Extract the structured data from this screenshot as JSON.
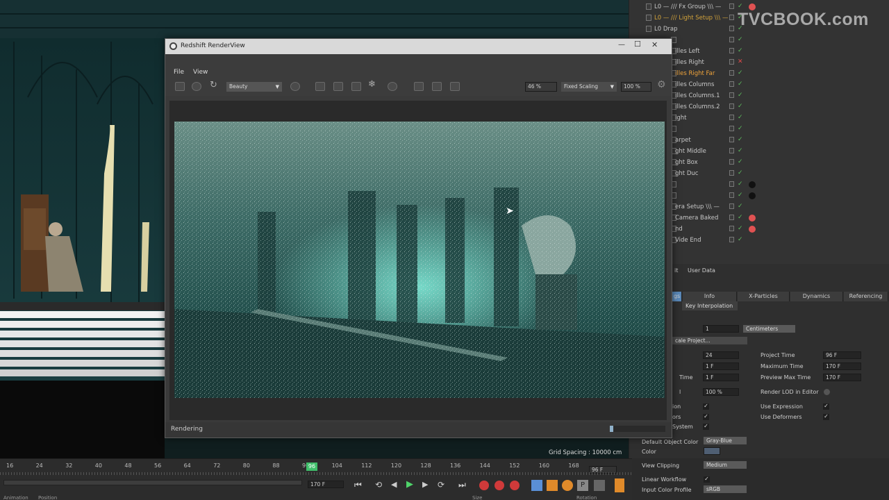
{
  "watermark": "TVCBOOK.com",
  "object_manager": {
    "rows": [
      {
        "label": "L0 — /// Fx Group \\\\\\ —",
        "color": "#c8c8c8",
        "dot": "#e05252"
      },
      {
        "label": "L0 — /// Light Setup \\\\\\ —",
        "color": "#d4a43b",
        "dot": ""
      },
      {
        "label": "L0 Drap",
        "color": "#c8c8c8",
        "dot": ""
      },
      {
        "label": "",
        "color": "#d4a43b",
        "dot": ""
      },
      {
        "label": "illes Left",
        "color": "#c8c8c8",
        "dot": ""
      },
      {
        "label": "illes Right",
        "color": "#c8c8c8",
        "dot": ""
      },
      {
        "label": "illes Right Far",
        "color": "#f0a43b",
        "dot": ""
      },
      {
        "label": "illes Columns",
        "color": "#c8c8c8",
        "dot": ""
      },
      {
        "label": "illes Columns.1",
        "color": "#c8c8c8",
        "dot": ""
      },
      {
        "label": "illes Columns.2",
        "color": "#c8c8c8",
        "dot": ""
      },
      {
        "label": "ight",
        "color": "#c8c8c8",
        "dot": ""
      },
      {
        "label": "",
        "color": "#c8c8c8",
        "dot": ""
      },
      {
        "label": "arpet",
        "color": "#c8c8c8",
        "dot": ""
      },
      {
        "label": "ght Middle",
        "color": "#c8c8c8",
        "dot": ""
      },
      {
        "label": "ght Box",
        "color": "#c8c8c8",
        "dot": ""
      },
      {
        "label": "ght Duc",
        "color": "#c8c8c8",
        "dot": ""
      },
      {
        "label": "",
        "color": "#c8c8c8",
        "dot": "#111111"
      },
      {
        "label": "",
        "color": "#c8c8c8",
        "dot": "#111111"
      },
      {
        "label": "era Setup \\\\\\ —",
        "color": "#c8c8c8",
        "dot": ""
      },
      {
        "label": "Camera Baked",
        "color": "#c8c8c8",
        "dot": "#e05252"
      },
      {
        "label": "nd",
        "color": "#c8c8c8",
        "dot": "#e05252"
      },
      {
        "label": "Vide End",
        "color": "#c8c8c8",
        "dot": ""
      }
    ]
  },
  "attributes": {
    "header": {
      "basic": "it",
      "user_data": "User Data"
    },
    "tabs": [
      "gs",
      "Info",
      "X-Particles",
      "Dynamics",
      "Referencing"
    ],
    "sub_tab": "Key Interpolation",
    "scale_value": "1",
    "scale_unit": "Centimeters",
    "scale_project": "cale Project...",
    "fps": "24",
    "min_time": "1 F",
    "preview_min": "1 F",
    "lod": "100 %",
    "project_time_label": "Project Time",
    "project_time": "96 F",
    "max_time_label": "Maximum Time",
    "max_time": "170 F",
    "preview_max_label": "Preview Max Time",
    "preview_max": "170 F",
    "render_lod_label": "Render LOD in Editor",
    "use_expression_label": "Use Expression",
    "use_deformers_label": "Use Deformers",
    "row_labels": {
      "time": "Time",
      "lod": "l",
      "ion": "ion",
      "ors": "ors",
      "system": "System"
    },
    "default_color_label": "Default Object Color",
    "default_color": "Gray-Blue",
    "color_label": "Color",
    "view_clipping_label": "View Clipping",
    "view_clipping": "Medium",
    "linear_workflow_label": "Linear Workflow",
    "input_color_profile_label": "Input Color Profile",
    "input_color_profile": "sRGB"
  },
  "renderview": {
    "title": "Redshift RenderView",
    "menu": [
      "File",
      "View"
    ],
    "aov": "Beauty",
    "zoom": "46 %",
    "scaling": "Fixed Scaling",
    "percent": "100 %",
    "status": "Rendering",
    "progress": 0.06
  },
  "viewport": {
    "grid_spacing": "Grid Spacing : 10000 cm"
  },
  "timeline": {
    "ticks": [
      "16",
      "24",
      "32",
      "40",
      "48",
      "56",
      "64",
      "72",
      "80",
      "88",
      "96",
      "104",
      "112",
      "120",
      "128",
      "136",
      "144",
      "152",
      "160",
      "168"
    ],
    "current_frame": "96",
    "end_label": "96 F",
    "end_field": "170 F",
    "bottom_labels": [
      "Animation",
      "Position",
      "Size",
      "Rotation"
    ]
  }
}
